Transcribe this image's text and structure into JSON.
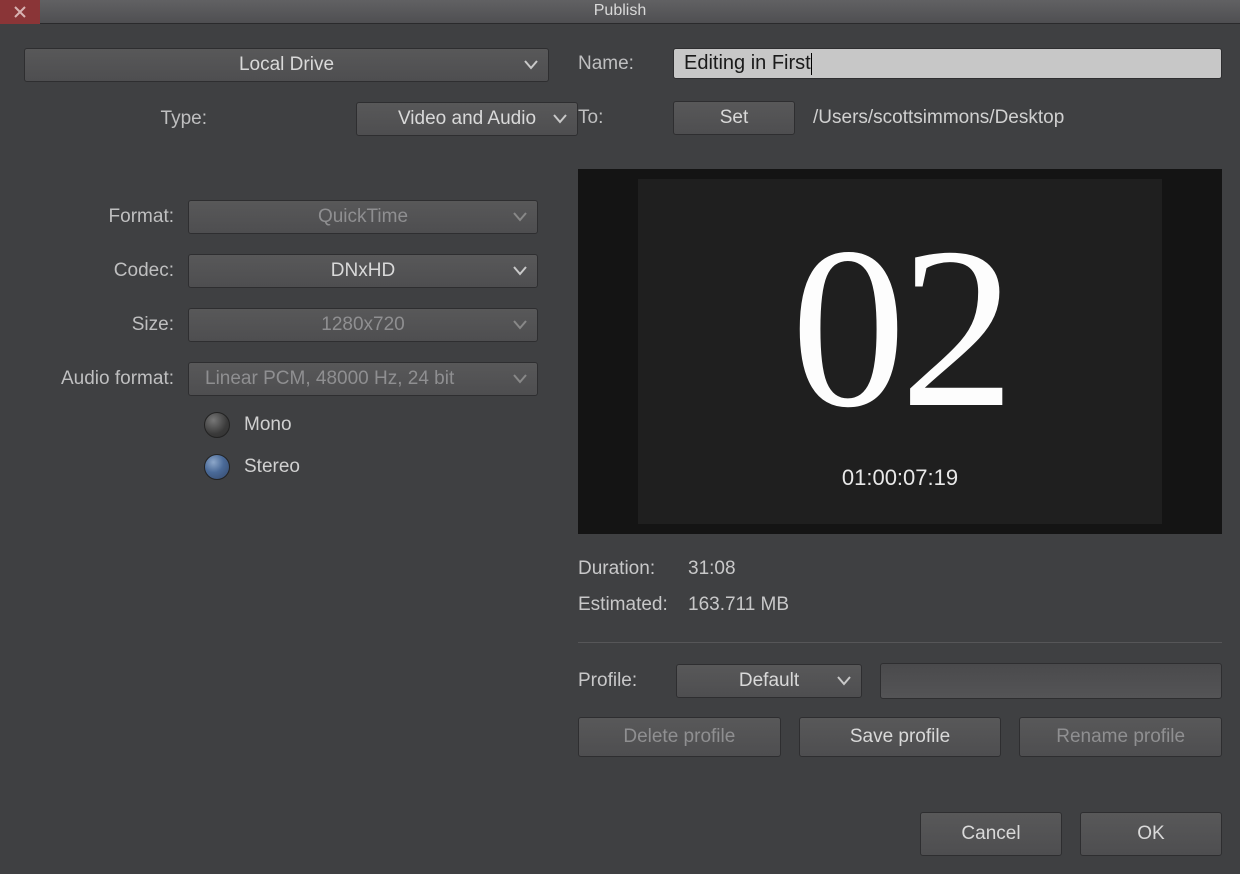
{
  "window": {
    "title": "Publish"
  },
  "top_destination": "Local Drive",
  "left": {
    "type_label": "Type:",
    "type_value": "Video and Audio",
    "format_label": "Format:",
    "format_value": "QuickTime",
    "codec_label": "Codec:",
    "codec_value": "DNxHD",
    "size_label": "Size:",
    "size_value": "1280x720",
    "audioformat_label": "Audio format:",
    "audioformat_value": "Linear PCM, 48000 Hz, 24 bit",
    "mono_label": "Mono",
    "stereo_label": "Stereo"
  },
  "right": {
    "name_label": "Name:",
    "name_value": "Editing in First",
    "to_label": "To:",
    "set_label": "Set",
    "path": "/Users/scottsimmons/Desktop",
    "preview_number": "02",
    "preview_timecode": "01:00:07:19",
    "duration_label": "Duration:",
    "duration_value": "31:08",
    "estimated_label": "Estimated:",
    "estimated_value": "163.711 MB",
    "profile_label": "Profile:",
    "profile_value": "Default",
    "delete_profile": "Delete profile",
    "save_profile": "Save profile",
    "rename_profile": "Rename profile"
  },
  "footer": {
    "cancel": "Cancel",
    "ok": "OK"
  }
}
